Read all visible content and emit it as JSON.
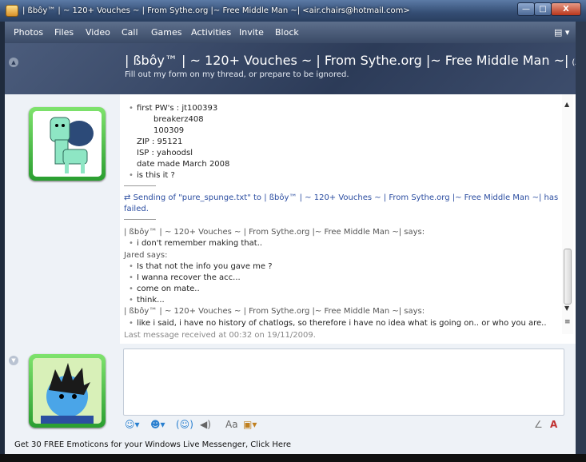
{
  "window": {
    "title": "| ßbôy™ | ~ 120+ Vouches ~ | From Sythe.org |~ Free Middle Man  ~| <air.chairs@hotmail.com>",
    "min": "—",
    "max": "□",
    "close": "X"
  },
  "menu": [
    "Photos",
    "Files",
    "Video",
    "Call",
    "Games",
    "Activities",
    "Invite",
    "Block"
  ],
  "header": {
    "name": "| ßbôy™ | ~ 120+ Vouches ~ | From Sythe.org |~ Free Middle Man  ~|",
    "status": "(Available)",
    "psm": "Fill out my form on my thread, or prepare to be ignored."
  },
  "conversation": {
    "lines": {
      "first_pws": "first PW's : jt100393",
      "pw2": "breakerz408",
      "pw3": "100309",
      "zip": "ZIP : 95121",
      "isp": "ISP : yahoodsl",
      "date": "date made March 2008",
      "isthis": "is this it ?",
      "transfer": "Sending of \"pure_spunge.txt\" to | ßbôy™ | ~ 120+ Vouches ~ | From Sythe.org |~ Free Middle Man  ~| has failed.",
      "transfer_l1": "Sending of \"pure_spunge.txt\" to | ßbôy™ | ~ 120+ Vouches ~ | From Sythe.org |~ Free Middle Man  ~| has",
      "transfer_l2": "failed.",
      "says1": "| ßbôy™ | ~ 120+ Vouches ~ | From Sythe.org |~ Free Middle Man  ~| says:",
      "m1": "i don't remember making that..",
      "jared": "Jared says:",
      "m2": "Is that not the info you gave me ?",
      "m3": "I wanna recover the acc...",
      "m4": "come on mate..",
      "m5": "think...",
      "says2": "| ßbôy™ | ~ 120+ Vouches ~ | From Sythe.org |~ Free Middle Man  ~| says:",
      "m6": "like i said, i have no history of chatlogs, so therefore i have no idea what is going on.. or who you are..",
      "last": "Last message received at 00:32 on 19/11/2009."
    }
  },
  "footer": {
    "link": "Get 30 FREE Emoticons for your Windows Live Messenger, Click Here"
  },
  "icons": {
    "emoticon": "smiley-icon",
    "wink": "wink-icon",
    "nudge": "nudge-icon",
    "voice": "voice-clip-icon",
    "font": "font-icon",
    "background": "background-icon",
    "handwriting": "handwriting-icon"
  }
}
